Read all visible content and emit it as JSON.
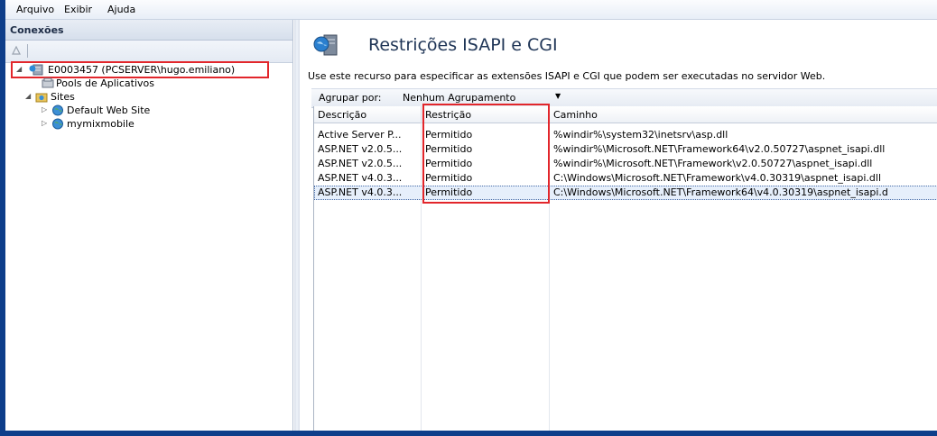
{
  "menu": [
    "Arquivo",
    "Exibir",
    "Ajuda"
  ],
  "connections": {
    "title": "Conexões",
    "tree": [
      {
        "label": "E0003457 (PCSERVER\\hugo.emiliano)",
        "icon": "server-icon"
      },
      {
        "label": "Pools de Aplicativos",
        "icon": "app-pools-icon"
      },
      {
        "label": "Sites",
        "icon": "sites-folder-icon"
      },
      {
        "label": "Default Web Site",
        "icon": "globe-icon"
      },
      {
        "label": "mymixmobile",
        "icon": "globe-icon"
      }
    ]
  },
  "feature": {
    "title": "Restrições ISAPI e CGI",
    "description": "Use este recurso para especificar as extensões ISAPI e CGI que podem ser executadas no servidor Web.",
    "group_label": "Agrupar por:",
    "group_value": "Nenhum Agrupamento"
  },
  "table": {
    "columns": [
      "Descrição",
      "Restrição",
      "Caminho"
    ],
    "rows": [
      [
        "Active Server P...",
        "Permitido",
        "%windir%\\system32\\inetsrv\\asp.dll"
      ],
      [
        "ASP.NET v2.0.5...",
        "Permitido",
        "%windir%\\Microsoft.NET\\Framework64\\v2.0.50727\\aspnet_isapi.dll"
      ],
      [
        "ASP.NET v2.0.5...",
        "Permitido",
        "%windir%\\Microsoft.NET\\Framework\\v2.0.50727\\aspnet_isapi.dll"
      ],
      [
        "ASP.NET v4.0.3...",
        "Permitido",
        "C:\\Windows\\Microsoft.NET\\Framework\\v4.0.30319\\aspnet_isapi.dll"
      ],
      [
        "ASP.NET v4.0.3...",
        "Permitido",
        "C:\\Windows\\Microsoft.NET\\Framework64\\v4.0.30319\\aspnet_isapi.d"
      ]
    ],
    "selected_row": 4
  },
  "colors": {
    "frame": "#0e3e8a",
    "highlight": "#e2262b",
    "title": "#1f3556"
  }
}
